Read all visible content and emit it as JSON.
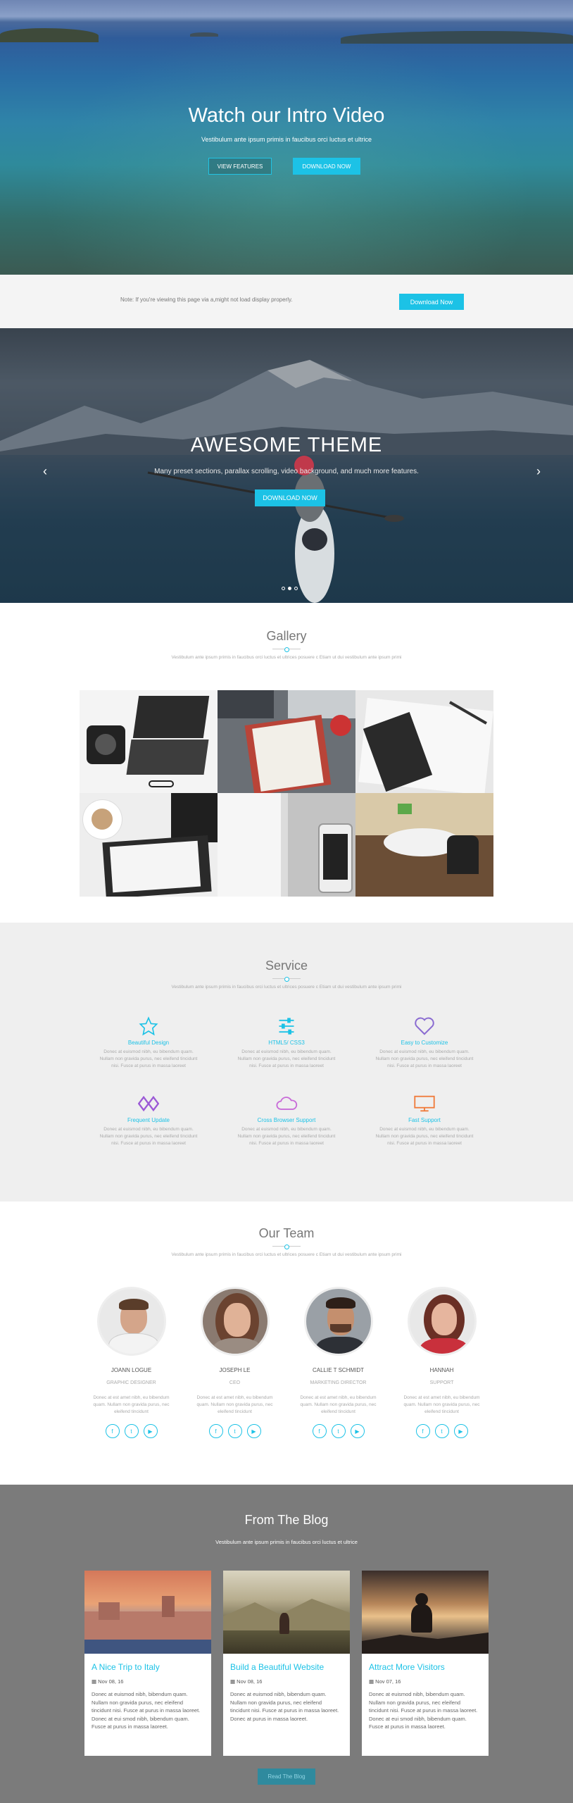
{
  "hero": {
    "title": "Watch our Intro Video",
    "subtitle": "Vestibulum ante ipsum primis in faucibus orci luctus et ultrice",
    "btn_features": "VIEW FEATURES",
    "btn_download": "DOWNLOAD NOW"
  },
  "notice": {
    "text": "Note: If you're viewing this page via a,might not load display properly.",
    "button": "Download Now"
  },
  "slider": {
    "title": "AWESOME THEME",
    "subtitle": "Many preset sections, parallax scrolling, video background, and much more features.",
    "button": "DOWNLOAD NOW",
    "prev": "‹",
    "next": "›",
    "active_slide": 2,
    "slide_count": 3
  },
  "gallery": {
    "title": "Gallery",
    "desc": "Vestibulum ante ipsum primis in faucibus orci luctus et ultrices posuere c Etiam ut dui vestibulum ante ipsum primi"
  },
  "service": {
    "title": "Service",
    "desc": "Vestibulum ante ipsum primis in faucibus orci luctus et ultrices posuere c Etiam ut dui vestibulum ante ipsum primi",
    "items": [
      {
        "title": "Beautiful Design",
        "icon": "star-icon",
        "color": "#1cc2e6",
        "desc": "Donec at euismod nibh, eu bibendum quam. Nullam non gravida purus, nec eleifend tincidunt nisi. Fusce at purus in massa laoreet"
      },
      {
        "title": "HTML5/ CSS3",
        "icon": "sliders-icon",
        "color": "#1cc2e6",
        "desc": "Donec at euismod nibh, eu bibendum quam. Nullam non gravida purus, nec eleifend tincidunt nisi. Fusce at purus in massa laoreet"
      },
      {
        "title": "Easy to Customize",
        "icon": "heart-icon",
        "color": "#8a6bd1",
        "desc": "Donec at euismod nibh, eu bibendum quam. Nullam non gravida purus, nec eleifend tincidunt nisi. Fusce at purus in massa laoreet"
      },
      {
        "title": "Frequent Update",
        "icon": "link-icon",
        "color": "#9b59d6",
        "desc": "Donec at euismod nibh, eu bibendum quam. Nullam non gravida purus, nec eleifend tincidunt nisi. Fusce at purus in massa laoreet"
      },
      {
        "title": "Cross Browser Support",
        "icon": "cloud-icon",
        "color": "#c86bd8",
        "desc": "Donec at euismod nibh, eu bibendum quam. Nullam non gravida purus, nec eleifend tincidunt nisi. Fusce at purus in massa laoreet"
      },
      {
        "title": "Fast Support",
        "icon": "monitor-icon",
        "color": "#f07a3a",
        "desc": "Donec at euismod nibh, eu bibendum quam. Nullam non gravida purus, nec eleifend tincidunt nisi. Fusce at purus in massa laoreet"
      }
    ]
  },
  "team": {
    "title": "Our Team",
    "desc": "Vestibulum ante ipsum primis in faucibus orci luctus et ultrices posuere c Etiam ut dui vestibulum ante ipsum primi",
    "members": [
      {
        "name": "JOANN LOGUE",
        "role": "GRAPHIC DESIGNER",
        "desc": "Donec at est amet nibh, eu bibendum quam. Nullam non gravida purus, nec eleifend tincidunt"
      },
      {
        "name": "JOSEPH LE",
        "role": "CEO",
        "desc": "Donec at est amet nibh, eu bibendum quam. Nullam non gravida purus, nec eleifend tincidunt"
      },
      {
        "name": "CALLIE T SCHMIDT",
        "role": "MARKETING DIRECTOR",
        "desc": "Donec at est amet nibh, eu bibendum quam. Nullam non gravida purus, nec eleifend tincidunt"
      },
      {
        "name": "HANNAH",
        "role": "SUPPORT",
        "desc": "Donec at est amet nibh, eu bibendum quam. Nullam non gravida purus, nec eleifend tincidunt"
      }
    ],
    "social": {
      "facebook": "f",
      "twitter": "t",
      "youtube": "▶"
    }
  },
  "blog": {
    "title": "From The Blog",
    "subtitle": "Vestibulum ante ipsum primis in faucibus orci luctus et ultrice",
    "button": "Read The Blog",
    "posts": [
      {
        "title": "A Nice Trip to Italy",
        "date": "Nov 08, 16",
        "excerpt": "Donec at euismod nibh, bibendum quam. Nullam non gravida purus, nec eleifend tincidunt nisi. Fusce at purus in massa laoreet. Donec at eui smod nibh, bibendum quam. Fusce at purus in massa laoreet."
      },
      {
        "title": "Build a Beautiful Website",
        "date": "Nov 08, 16",
        "excerpt": "Donec at euismod nibh, bibendum quam. Nullam non gravida purus, nec eleifend tincidunt nisi. Fusce at purus in massa laoreet. Donec at purus in massa laoreet."
      },
      {
        "title": "Attract More Visitors",
        "date": "Nov 07, 16",
        "excerpt": "Donec at euismod nibh, bibendum quam. Nullam non gravida purus, nec eleifend tincidunt nisi. Fusce at purus in massa laoreet. Donec at eui smod nibh, bibendum quam. Fusce at purus in massa laoreet."
      }
    ]
  },
  "colors": {
    "accent": "#1cc2e6",
    "blog_bg": "#7b7b7b",
    "service_bg": "#efefef"
  }
}
